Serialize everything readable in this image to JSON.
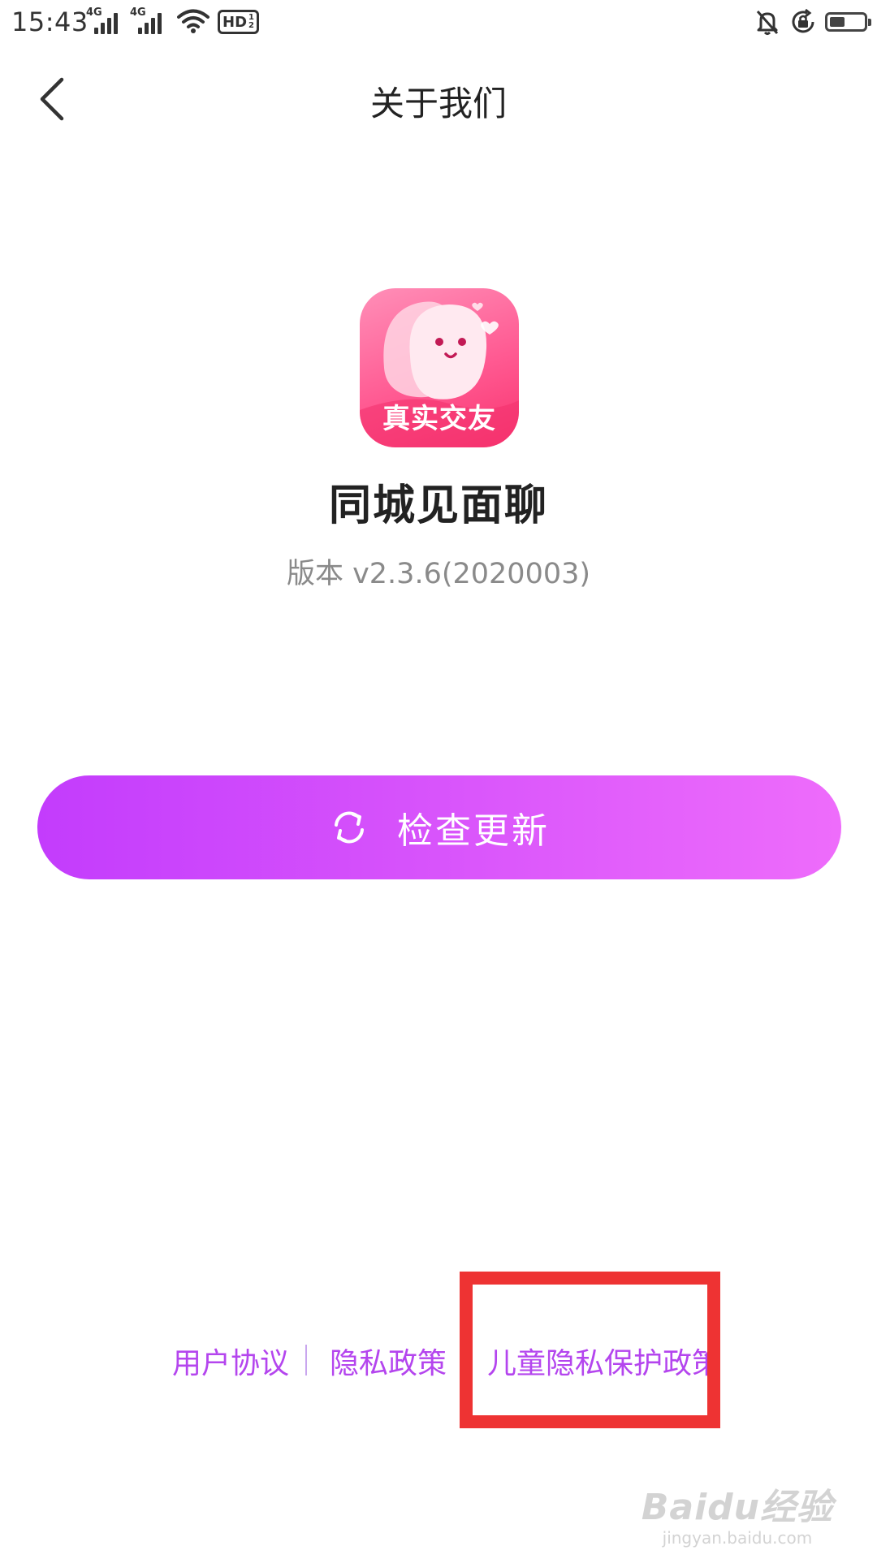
{
  "status_bar": {
    "time": "15:43",
    "signal_1_label": "4G",
    "signal_2_label": "4G",
    "hd_label": "HD",
    "hd_sub_1": "1",
    "hd_sub_2": "2",
    "battery_level": 0.45,
    "icons": [
      "signal-icon",
      "signal-icon",
      "wifi-icon",
      "hd-icon",
      "mute-icon",
      "lock-rotate-icon",
      "battery-icon"
    ]
  },
  "header": {
    "title": "关于我们",
    "back_icon": "chevron-left-icon"
  },
  "app": {
    "icon_caption": "真实交友",
    "name": "同城见面聊",
    "version": "版本 v2.3.6(2020003)"
  },
  "update_button": {
    "icon": "refresh-icon",
    "label": "检查更新",
    "gradient_start": "#c33cfc",
    "gradient_end": "#ee6cfb"
  },
  "footer": {
    "links": [
      {
        "label": "用户协议"
      },
      {
        "label": "隐私政策"
      },
      {
        "label": "儿童隐私保护政策"
      }
    ],
    "link_color": "#b445ee",
    "highlight_color": "#ee3333"
  },
  "watermark": {
    "brand": "Baidu经验",
    "url": "jingyan.baidu.com"
  }
}
